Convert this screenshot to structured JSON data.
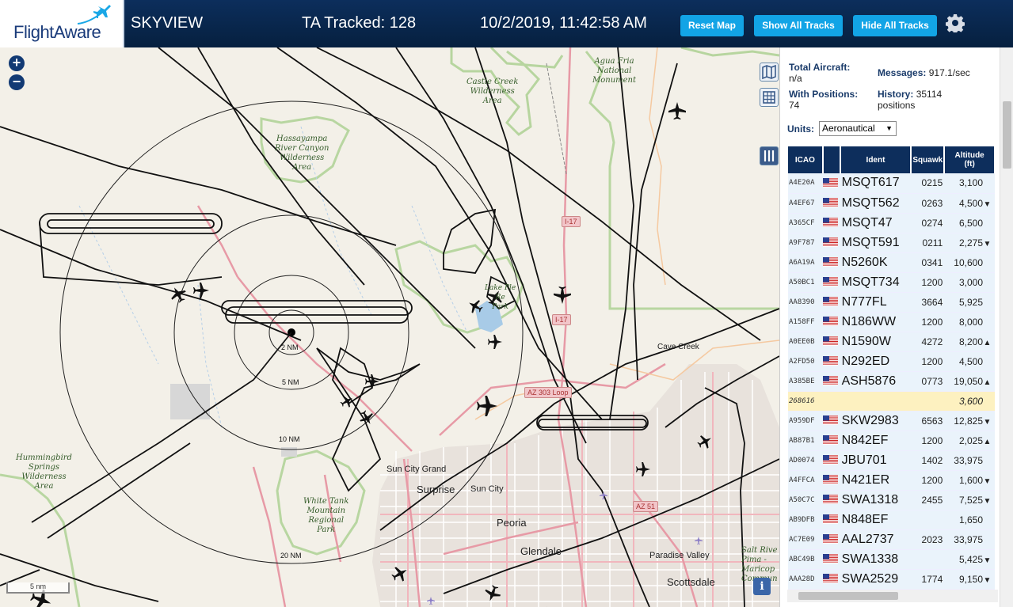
{
  "header": {
    "logo": "FlightAware",
    "app_name": "SKYVIEW",
    "ta_tracked": "TA Tracked: 128",
    "datetime": "10/2/2019, 11:42:58 AM",
    "buttons": {
      "reset": "Reset Map",
      "show_all": "Show All Tracks",
      "hide_all": "Hide All Tracks"
    }
  },
  "map": {
    "labels": {
      "agua_fria": "Agua Fria\nNational\nMonument",
      "castle_creek": "Castle Creek\nWilderness\nArea",
      "hassayampa": "Hassayampa\nRiver Canyon\nWilderness\nArea",
      "hummingbird": "Hummingbird\nSprings\nWilderness\nArea",
      "white_tank": "White Tank\nMountain\nRegional\nPark",
      "salt_river": "Salt Rive\nPima -\nMaricop\nCommun",
      "lake_pleasant": "Lake Ple\nRe\nPark"
    },
    "cities": {
      "cave_creek": "Cave Creek",
      "sun_city_grand": "Sun City Grand",
      "surprise": "Surprise",
      "sun_city": "Sun City",
      "peoria": "Peoria",
      "glendale": "Glendale",
      "paradise_valley": "Paradise Valley",
      "scottsdale": "Scottsdale"
    },
    "rings": {
      "r2": "2 NM",
      "r5": "5 NM",
      "r10": "10 NM",
      "r20": "20 NM"
    },
    "highways": {
      "i17a": "I-17",
      "i17b": "I-17",
      "az303": "AZ 303 Loop",
      "az51": "AZ 51"
    },
    "scale": "5 nm",
    "info": "i"
  },
  "stats": {
    "total_label": "Total Aircraft:",
    "total_value": "n/a",
    "positions_label": "With Positions:",
    "positions_value": "74",
    "messages_label": "Messages:",
    "messages_value": "917.1/sec",
    "history_label": "History:",
    "history_value": "35114",
    "history_unit": "positions",
    "units_label": "Units:",
    "units_value": "Aeronautical"
  },
  "table": {
    "headers": {
      "icao": "ICAO",
      "ident": "Ident",
      "squawk": "Squawk",
      "altitude": "Altitude\n(ft)"
    },
    "rows": [
      {
        "icao": "A4E20A",
        "ident": "MSQT617",
        "squawk": "0215",
        "alt": "3,100",
        "trend": ""
      },
      {
        "icao": "A4EF67",
        "ident": "MSQT562",
        "squawk": "0263",
        "alt": "4,500",
        "trend": "▼"
      },
      {
        "icao": "A365CF",
        "ident": "MSQT47",
        "squawk": "0274",
        "alt": "6,500",
        "trend": ""
      },
      {
        "icao": "A9F787",
        "ident": "MSQT591",
        "squawk": "0211",
        "alt": "2,275",
        "trend": "▼"
      },
      {
        "icao": "A6A19A",
        "ident": "N5260K",
        "squawk": "0341",
        "alt": "10,600",
        "trend": ""
      },
      {
        "icao": "A50BC1",
        "ident": "MSQT734",
        "squawk": "1200",
        "alt": "3,000",
        "trend": ""
      },
      {
        "icao": "AA8390",
        "ident": "N777FL",
        "squawk": "3664",
        "alt": "5,925",
        "trend": ""
      },
      {
        "icao": "A158FF",
        "ident": "N186WW",
        "squawk": "1200",
        "alt": "8,000",
        "trend": ""
      },
      {
        "icao": "A0EE0B",
        "ident": "N1590W",
        "squawk": "4272",
        "alt": "8,200",
        "trend": "▲"
      },
      {
        "icao": "A2FD50",
        "ident": "N292ED",
        "squawk": "1200",
        "alt": "4,500",
        "trend": ""
      },
      {
        "icao": "A385BE",
        "ident": "ASH5876",
        "squawk": "0773",
        "alt": "19,050",
        "trend": "▲"
      },
      {
        "icao": "268616",
        "ident": "",
        "squawk": "",
        "alt": "3,600",
        "trend": "",
        "highlight": true,
        "noflag": true
      },
      {
        "icao": "A959DF",
        "ident": "SKW2983",
        "squawk": "6563",
        "alt": "12,825",
        "trend": "▼"
      },
      {
        "icao": "AB87B1",
        "ident": "N842EF",
        "squawk": "1200",
        "alt": "2,025",
        "trend": "▲"
      },
      {
        "icao": "AD0074",
        "ident": "JBU701",
        "squawk": "1402",
        "alt": "33,975",
        "trend": ""
      },
      {
        "icao": "A4FFCA",
        "ident": "N421ER",
        "squawk": "1200",
        "alt": "1,600",
        "trend": "▼"
      },
      {
        "icao": "A50C7C",
        "ident": "SWA1318",
        "squawk": "2455",
        "alt": "7,525",
        "trend": "▼"
      },
      {
        "icao": "AB9DFB",
        "ident": "N848EF",
        "squawk": "",
        "alt": "1,650",
        "trend": ""
      },
      {
        "icao": "AC7E09",
        "ident": "AAL2737",
        "squawk": "2023",
        "alt": "33,975",
        "trend": ""
      },
      {
        "icao": "ABC49B",
        "ident": "SWA1338",
        "squawk": "",
        "alt": "5,425",
        "trend": "▼"
      },
      {
        "icao": "AAA28D",
        "ident": "SWA2529",
        "squawk": "1774",
        "alt": "9,150",
        "trend": "▼"
      }
    ]
  },
  "colors": {
    "header_bg": "#0c2e5c",
    "button": "#12a4e6",
    "table_header": "#0d2e5c",
    "highlight_row": "#fdf1c0"
  }
}
